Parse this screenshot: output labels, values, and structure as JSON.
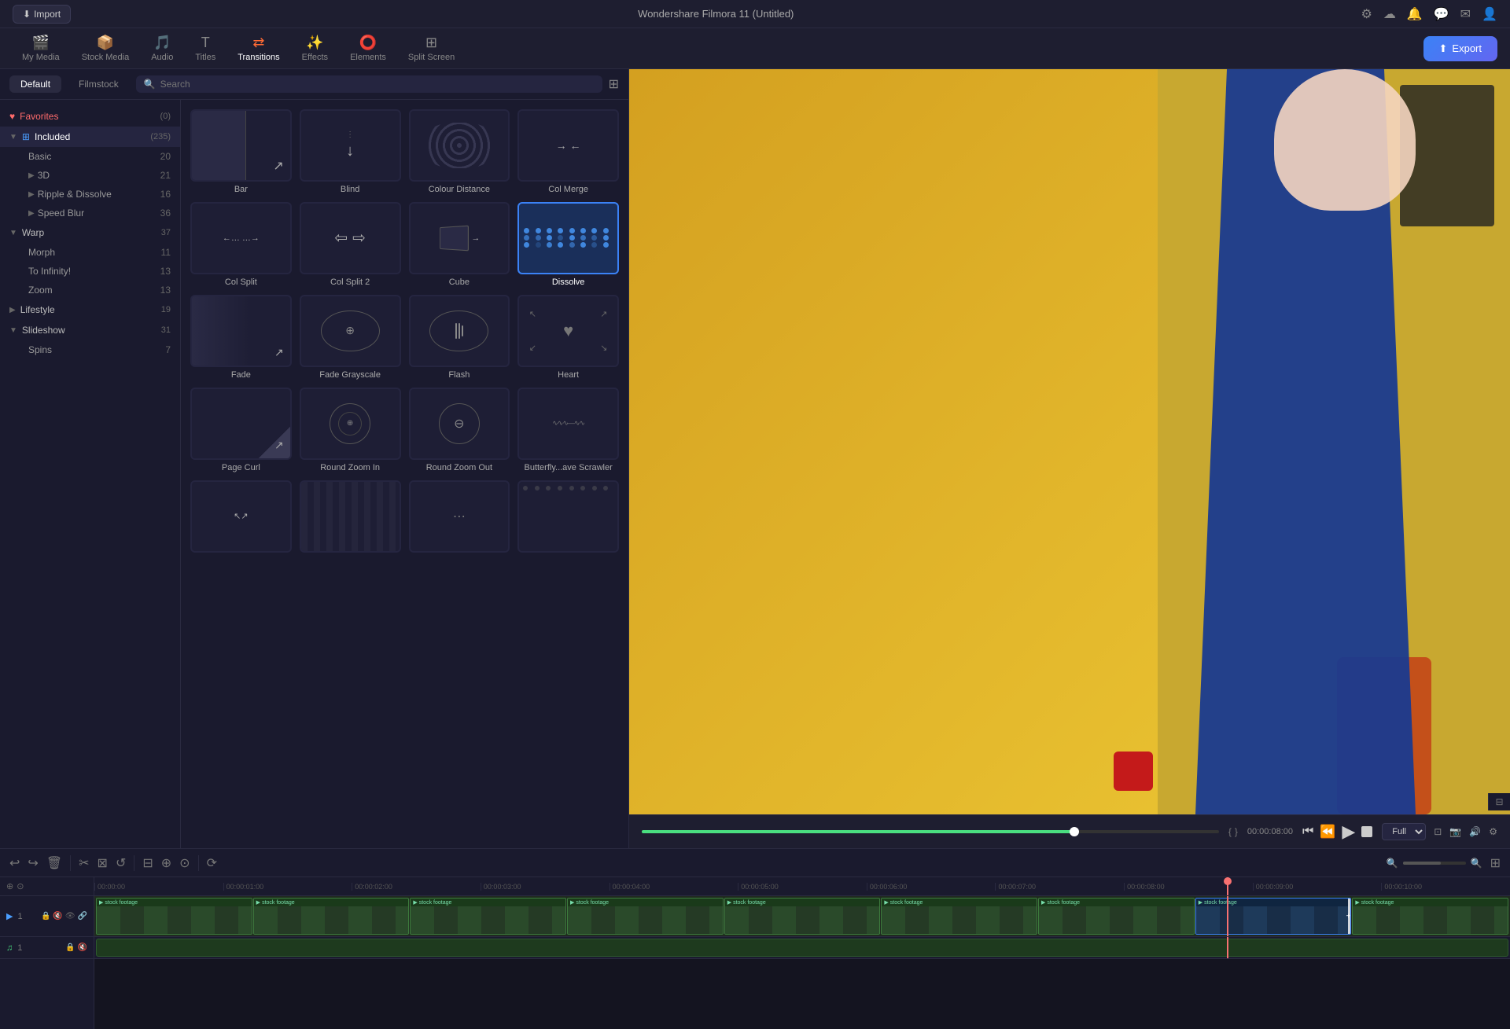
{
  "app": {
    "title": "Wondershare Filmora 11 (Untitled)",
    "import_label": "Import",
    "export_label": "Export"
  },
  "nav": {
    "tabs": [
      {
        "id": "my-media",
        "label": "My Media",
        "icon": "🎬",
        "active": false
      },
      {
        "id": "stock-media",
        "label": "Stock Media",
        "icon": "📦",
        "active": false
      },
      {
        "id": "audio",
        "label": "Audio",
        "icon": "🎵",
        "active": false
      },
      {
        "id": "titles",
        "label": "Titles",
        "icon": "T",
        "active": false
      },
      {
        "id": "transitions",
        "label": "Transitions",
        "icon": "▶▶",
        "active": true
      },
      {
        "id": "effects",
        "label": "Effects",
        "icon": "✨",
        "active": false
      },
      {
        "id": "elements",
        "label": "Elements",
        "icon": "⭕",
        "active": false
      },
      {
        "id": "split-screen",
        "label": "Split Screen",
        "icon": "⊞",
        "active": false
      }
    ]
  },
  "panel": {
    "tabs": [
      {
        "id": "default",
        "label": "Default",
        "active": true
      },
      {
        "id": "filmstock",
        "label": "Filmstock",
        "active": false
      }
    ],
    "search_placeholder": "Search"
  },
  "sidebar": {
    "items": [
      {
        "id": "favorites",
        "label": "Favorites",
        "count": "(0)",
        "type": "favorites",
        "expanded": false
      },
      {
        "id": "included",
        "label": "Included",
        "count": "(235)",
        "type": "group",
        "expanded": true,
        "icon": "⊞"
      },
      {
        "id": "basic",
        "label": "Basic",
        "count": "20",
        "type": "subitem",
        "indent": true
      },
      {
        "id": "3d",
        "label": "3D",
        "count": "21",
        "type": "subitem",
        "indent": true
      },
      {
        "id": "ripple-dissolve",
        "label": "Ripple & Dissolve",
        "count": "16",
        "type": "subitem",
        "indent": true
      },
      {
        "id": "speed-blur",
        "label": "Speed Blur",
        "count": "36",
        "type": "subitem",
        "indent": true
      },
      {
        "id": "warp",
        "label": "Warp",
        "count": "37",
        "type": "group",
        "expanded": true
      },
      {
        "id": "morph",
        "label": "Morph",
        "count": "11",
        "type": "subitem",
        "indent": true
      },
      {
        "id": "to-infinity",
        "label": "To Infinity!",
        "count": "13",
        "type": "subitem",
        "indent": true
      },
      {
        "id": "zoom",
        "label": "Zoom",
        "count": "13",
        "type": "subitem",
        "indent": true
      },
      {
        "id": "lifestyle",
        "label": "Lifestyle",
        "count": "19",
        "type": "item"
      },
      {
        "id": "slideshow",
        "label": "Slideshow",
        "count": "31",
        "type": "group",
        "expanded": false
      },
      {
        "id": "spins",
        "label": "Spins",
        "count": "7",
        "type": "subitem",
        "indent": true
      }
    ]
  },
  "transitions": {
    "items": [
      {
        "id": "bar",
        "label": "Bar",
        "pattern": "bar",
        "selected": false
      },
      {
        "id": "blind",
        "label": "Blind",
        "pattern": "blind",
        "selected": false
      },
      {
        "id": "colour-distance",
        "label": "Colour Distance",
        "pattern": "wavy",
        "selected": false
      },
      {
        "id": "col-merge",
        "label": "Col Merge",
        "pattern": "col-merge",
        "selected": false
      },
      {
        "id": "col-split",
        "label": "Col Split",
        "pattern": "col-split",
        "selected": false
      },
      {
        "id": "col-split-2",
        "label": "Col Split 2",
        "pattern": "col-split-2",
        "selected": false
      },
      {
        "id": "cube",
        "label": "Cube",
        "pattern": "cube",
        "selected": false
      },
      {
        "id": "dissolve",
        "label": "Dissolve",
        "pattern": "dissolve-dots",
        "selected": true
      },
      {
        "id": "fade",
        "label": "Fade",
        "pattern": "fade",
        "selected": false
      },
      {
        "id": "fade-grayscale",
        "label": "Fade Grayscale",
        "pattern": "fade-grayscale",
        "selected": false
      },
      {
        "id": "flash",
        "label": "Flash",
        "pattern": "flash",
        "selected": false
      },
      {
        "id": "heart",
        "label": "Heart",
        "pattern": "heart",
        "selected": false
      },
      {
        "id": "page-curl",
        "label": "Page Curl",
        "pattern": "page-curl",
        "selected": false
      },
      {
        "id": "round-zoom-in",
        "label": "Round Zoom In",
        "pattern": "round-zoom-in",
        "selected": false
      },
      {
        "id": "round-zoom-out",
        "label": "Round Zoom Out",
        "pattern": "round-zoom-out",
        "selected": false
      },
      {
        "id": "butterfly-scrawler",
        "label": "Butterfly...ave Scrawler",
        "pattern": "butterfly",
        "selected": false
      }
    ]
  },
  "preview": {
    "time_current": "00:00:08:00",
    "time_display": "00:00:08:00",
    "quality": "Full",
    "progress_pct": 75
  },
  "timeline": {
    "markers": [
      "00:00:00",
      "00:00:01:00",
      "00:00:02:00",
      "00:00:03:00",
      "00:00:04:00",
      "00:00:05:00",
      "00:00:06:00",
      "00:00:07:00",
      "00:00:08:00",
      "00:00:09:00",
      "00:00:10:00"
    ],
    "tracks": [
      {
        "id": "video-1",
        "type": "video",
        "number": 1
      },
      {
        "id": "audio-1",
        "type": "audio",
        "number": 1
      }
    ]
  }
}
